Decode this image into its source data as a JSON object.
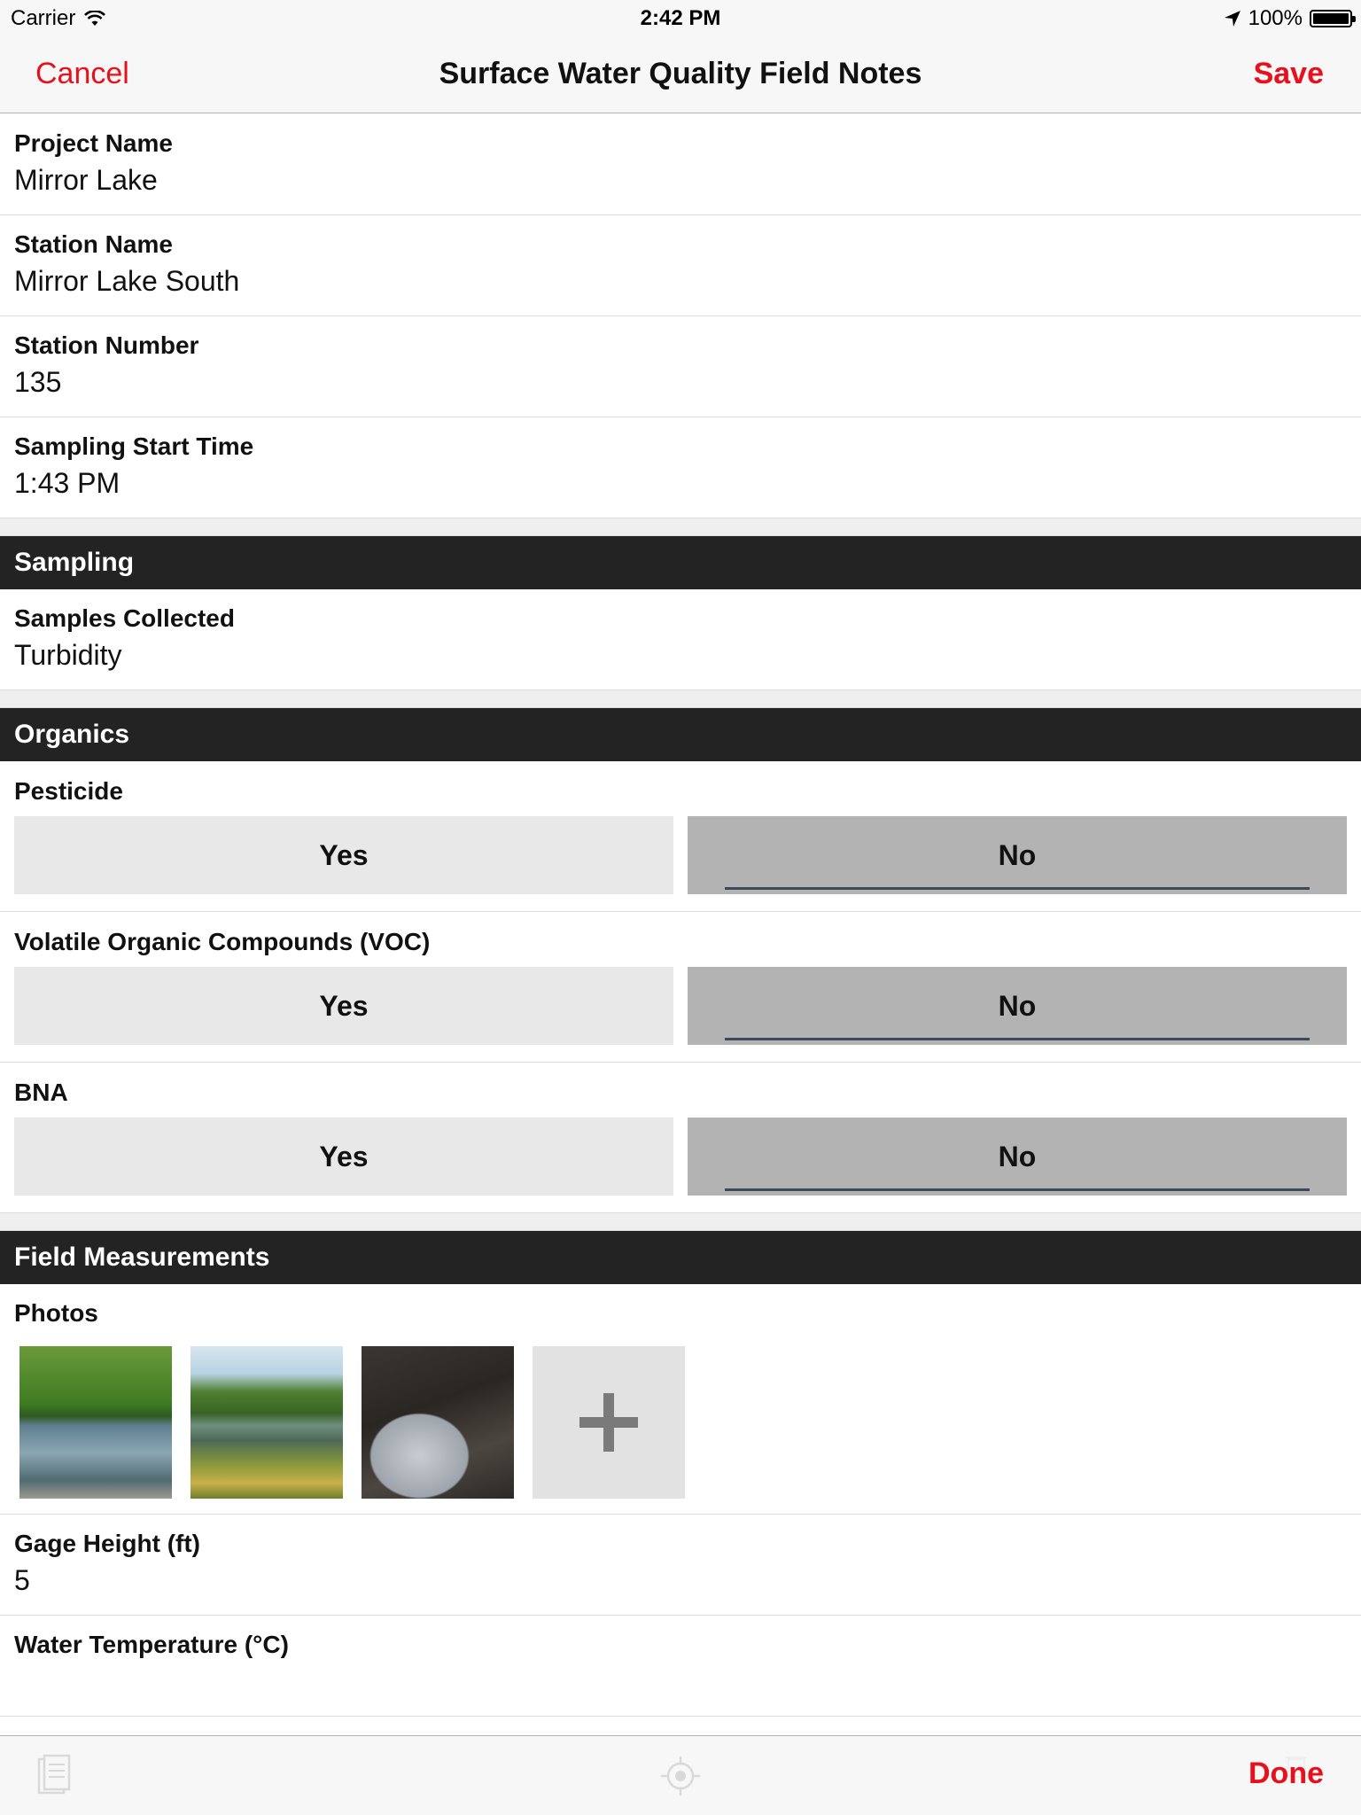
{
  "status_bar": {
    "carrier": "Carrier",
    "time": "2:42 PM",
    "battery": "100%",
    "battery_level": 1.0
  },
  "nav": {
    "cancel_label": "Cancel",
    "title": "Surface Water Quality Field Notes",
    "save_label": "Save"
  },
  "fields": {
    "project_name": {
      "label": "Project Name",
      "value": "Mirror Lake"
    },
    "station_name": {
      "label": "Station Name",
      "value": "Mirror Lake South"
    },
    "station_number": {
      "label": "Station Number",
      "value": "135"
    },
    "sampling_start_time": {
      "label": "Sampling Start Time",
      "value": "1:43 PM"
    }
  },
  "sections": {
    "sampling": {
      "title": "Sampling",
      "samples_collected": {
        "label": "Samples Collected",
        "value": "Turbidity"
      }
    },
    "organics": {
      "title": "Organics",
      "pesticide": {
        "label": "Pesticide",
        "yes": "Yes",
        "no": "No",
        "selected": "No"
      },
      "voc": {
        "label": "Volatile Organic Compounds (VOC)",
        "yes": "Yes",
        "no": "No",
        "selected": "No"
      },
      "bna": {
        "label": "BNA",
        "yes": "Yes",
        "no": "No",
        "selected": "No"
      }
    },
    "field_measurements": {
      "title": "Field Measurements",
      "photos": {
        "label": "Photos",
        "count": 3
      },
      "gage_height": {
        "label": "Gage Height (ft)",
        "value": "5"
      },
      "water_temperature": {
        "label": "Water Temperature (°C)",
        "value": ""
      }
    }
  },
  "toolbar": {
    "done_label": "Done",
    "icons": [
      "document-icon",
      "locate-icon"
    ]
  },
  "colors": {
    "accent": "#e8111b",
    "section_header": "#232323",
    "toggle_unselected": "#e8e8e8",
    "toggle_selected": "#b3b3b3"
  }
}
